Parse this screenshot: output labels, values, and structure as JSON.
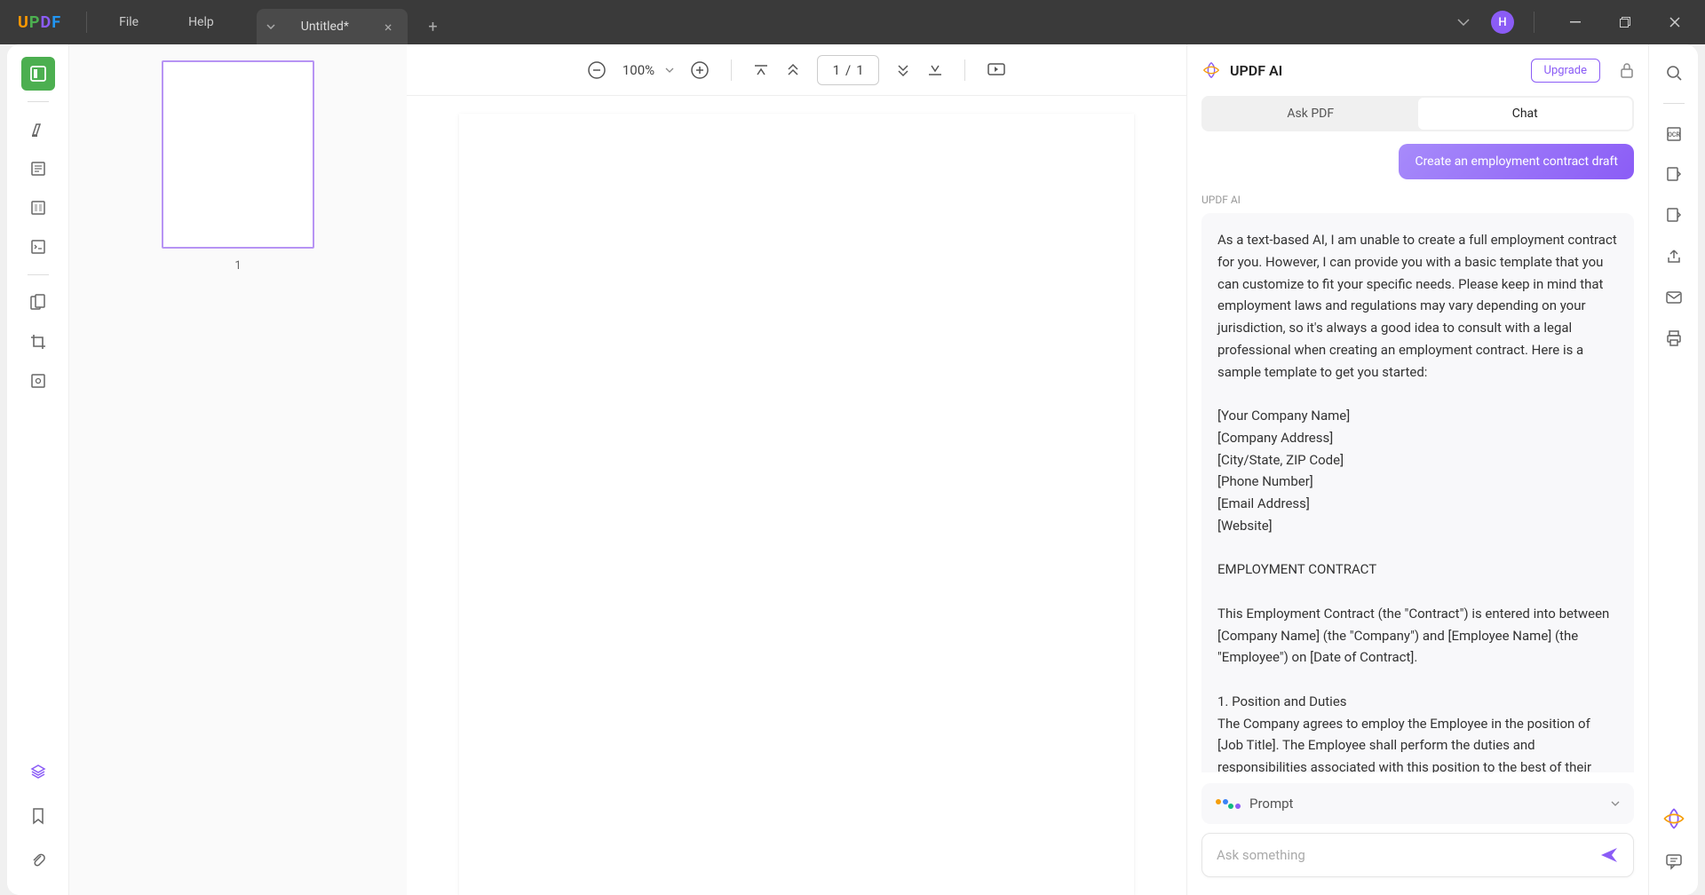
{
  "titlebar": {
    "logo": {
      "u": "U",
      "p": "P",
      "d": "D",
      "f": "F"
    },
    "menu": {
      "file": "File",
      "help": "Help"
    },
    "tab": {
      "title": "Untitled*"
    },
    "avatar": "H"
  },
  "thumbnails": {
    "page1_label": "1"
  },
  "doc_toolbar": {
    "zoom": "100%",
    "page_current": "1",
    "page_sep": "/",
    "page_total": "1"
  },
  "ai": {
    "title": "UPDF AI",
    "upgrade": "Upgrade",
    "tabs": {
      "ask": "Ask PDF",
      "chat": "Chat"
    },
    "user_message": "Create an employment contract draft",
    "ai_label": "UPDF AI",
    "ai_response": "As a text-based AI, I am unable to create a full employment contract for you. However, I can provide you with a basic template that you can customize to fit your specific needs. Please keep in mind that employment laws and regulations may vary depending on your jurisdiction, so it's always a good idea to consult with a legal professional when creating an employment contract. Here is a sample template to get you started:\n\n[Your Company Name]\n[Company Address]\n[City/State, ZIP Code]\n[Phone Number]\n[Email Address]\n[Website]\n\nEMPLOYMENT CONTRACT\n\nThis Employment Contract (the \"Contract\") is entered into between [Company Name] (the \"Company\") and [Employee Name] (the \"Employee\") on [Date of Contract].\n\n1. Position and Duties\nThe Company agrees to employ the Employee in the position of [Job Title]. The Employee shall perform the duties and responsibilities associated with this position to the best of their abilities, and abide by all policies and procedures set forth by the Company",
    "prompt_label": "Prompt",
    "input_placeholder": "Ask something"
  }
}
